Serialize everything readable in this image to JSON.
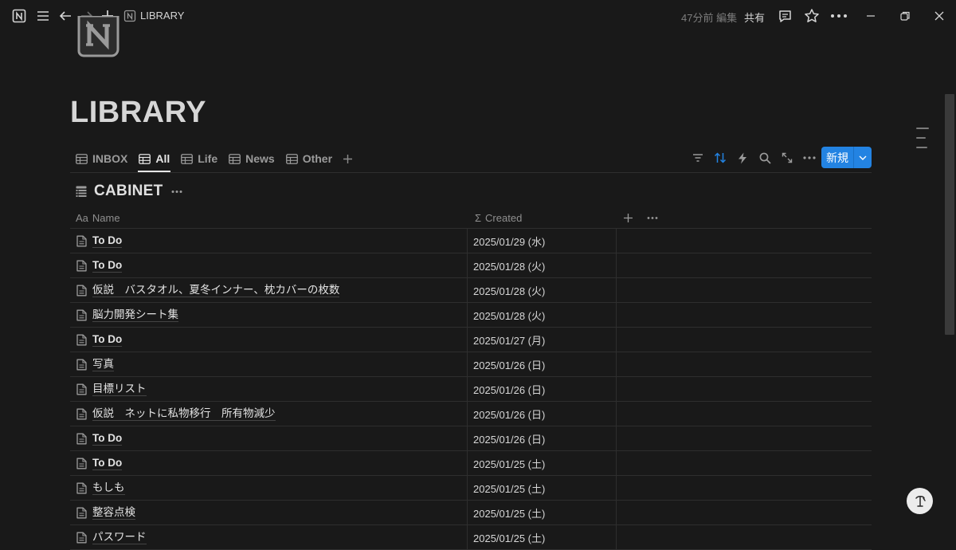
{
  "titlebar": {
    "title": "LIBRARY",
    "edited": "47分前 編集",
    "share": "共有",
    "icons": [
      "notion-logo-icon",
      "menu-icon",
      "back-arrow-icon",
      "forward-arrow-icon",
      "plus-icon",
      "page-notion-icon",
      "comment-icon",
      "star-icon",
      "more-horizontal-icon",
      "minimize-icon",
      "restore-icon",
      "close-icon"
    ]
  },
  "page": {
    "title": "LIBRARY",
    "icon": "notion-logo-icon"
  },
  "tabs": [
    {
      "label": "INBOX",
      "active": false
    },
    {
      "label": "All",
      "active": true
    },
    {
      "label": "Life",
      "active": false
    },
    {
      "label": "News",
      "active": false
    },
    {
      "label": "Other",
      "active": false
    }
  ],
  "toolbar": {
    "new_label": "新規",
    "icons": [
      "filter-icon",
      "sort-icon",
      "automation-bolt-icon",
      "search-icon",
      "expand-icon",
      "more-horizontal-icon"
    ],
    "accent": "#2383e2"
  },
  "database": {
    "title": "CABINET",
    "columns": [
      {
        "prefix": "Aa",
        "label": "Name"
      },
      {
        "prefix": "Σ",
        "label": "Created"
      }
    ],
    "rows": [
      {
        "name": "To Do",
        "created": "2025/01/29 (水)"
      },
      {
        "name": "To Do",
        "created": "2025/01/28 (火)"
      },
      {
        "name": "仮説　バスタオル、夏冬インナー、枕カバーの枚数",
        "created": "2025/01/28 (火)"
      },
      {
        "name": "脳力開発シート集",
        "created": "2025/01/28 (火)"
      },
      {
        "name": "To Do",
        "created": "2025/01/27 (月)"
      },
      {
        "name": "写真",
        "created": "2025/01/26 (日)"
      },
      {
        "name": "目標リスト",
        "created": "2025/01/26 (日)"
      },
      {
        "name": "仮説　ネットに私物移行　所有物減少",
        "created": "2025/01/26 (日)"
      },
      {
        "name": "To Do",
        "created": "2025/01/26 (日)"
      },
      {
        "name": "To Do",
        "created": "2025/01/25 (土)"
      },
      {
        "name": "もしも",
        "created": "2025/01/25 (土)"
      },
      {
        "name": "整容点検",
        "created": "2025/01/25 (土)"
      },
      {
        "name": "パスワード",
        "created": "2025/01/25 (土)"
      }
    ]
  },
  "colors": {
    "background": "#191919",
    "text": "#d4d4d4",
    "muted": "#9b9b9b",
    "divider": "#2e2e2e"
  }
}
